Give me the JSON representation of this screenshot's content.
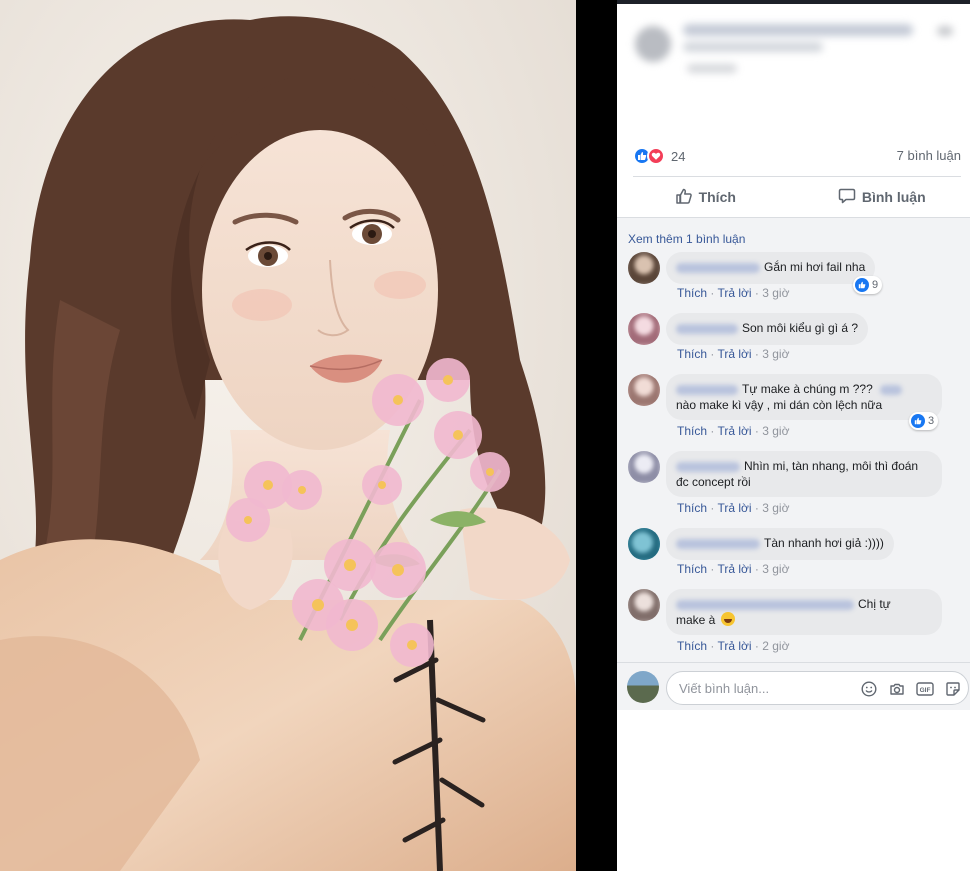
{
  "post": {
    "reaction_count": "24",
    "comment_count_label": "7 bình luận",
    "like_action": "Thích",
    "comment_action": "Bình luận",
    "see_more": "Xem thêm 1 bình luận"
  },
  "comments": [
    {
      "text": "Gắn mi hơi fail nha",
      "like": "Thích",
      "reply": "Trả lời",
      "time": "3 giờ",
      "reactions": "9"
    },
    {
      "text": "Son môi kiểu gì gì á ?",
      "like": "Thích",
      "reply": "Trả lời",
      "time": "3 giờ"
    },
    {
      "text_line1": "Tự make à chúng m ???",
      "text_line2": "nào make kì vậy , mi dán còn lệch nữa",
      "like": "Thích",
      "reply": "Trả lời",
      "time": "3 giờ",
      "reactions": "3"
    },
    {
      "text_line1": "Nhìn mi, tàn nhang, môi thì đoán",
      "text_line2": "đc concept rồi",
      "like": "Thích",
      "reply": "Trả lời",
      "time": "3 giờ"
    },
    {
      "text": "Tàn nhanh hơi giả :))))",
      "like": "Thích",
      "reply": "Trả lời",
      "time": "3 giờ"
    },
    {
      "text_line1": "Chị tự",
      "text_line2": "make à",
      "like": "Thích",
      "reply": "Trả lời",
      "time": "2 giờ"
    }
  ],
  "composer": {
    "placeholder": "Viết bình luận..."
  },
  "icons": [
    "like-icon",
    "love-icon",
    "comment-icon",
    "smiley-icon",
    "camera-icon",
    "gif-icon",
    "sticker-icon"
  ],
  "colors": {
    "link": "#385898",
    "like_blue": "#1877f2",
    "love_red": "#f33e58",
    "comment_bg": "#f2f3f5",
    "bubble_bg": "#e8e9eb"
  }
}
